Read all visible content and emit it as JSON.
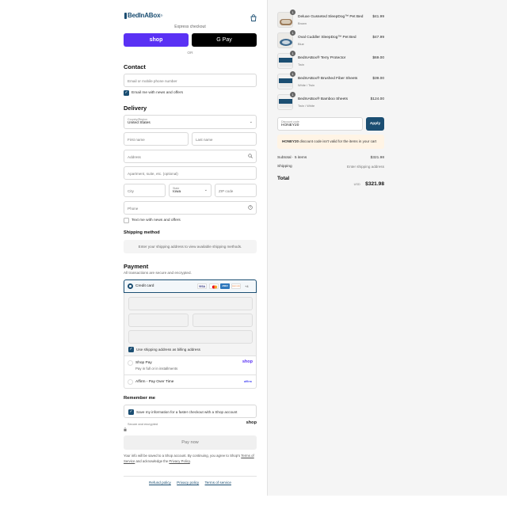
{
  "header": {
    "logo": "BedInABox",
    "logo_suffix": "®",
    "cart_icon": "shopping-bag-icon"
  },
  "express": {
    "title": "Express checkout",
    "shop_pay_label": "shop",
    "gpay_label": "G Pay",
    "or_label": "OR"
  },
  "contact": {
    "heading": "Contact",
    "email_placeholder": "Email or mobile phone number",
    "news_label": "Email me with news and offers",
    "news_checked": true
  },
  "delivery": {
    "heading": "Delivery",
    "country_label": "Country/Region",
    "country_value": "United States",
    "first_name": "First name",
    "last_name": "Last name",
    "address": "Address",
    "apartment": "Apartment, suite, etc. (optional)",
    "city": "City",
    "state_label": "State",
    "state_value": "Iowa",
    "zip": "ZIP code",
    "phone": "Phone",
    "sms_label": "Text me with news and offers"
  },
  "shipping_method": {
    "heading": "Shipping method",
    "notice": "Enter your shipping address to view available shipping methods."
  },
  "payment": {
    "heading": "Payment",
    "subtitle": "All transactions are secure and encrypted.",
    "credit_card_label": "Credit card",
    "card_brands": [
      "VISA",
      "MC",
      "AMEX",
      "DISCOVER"
    ],
    "more_brands": "+4",
    "billing_label": "Use shipping address as billing address",
    "shop_pay_title": "Shop Pay",
    "shop_pay_sub": "Pay in full or in installments",
    "shop_pay_logo": "shop",
    "affirm_label": "Affirm - Pay Over Time",
    "affirm_logo": "affirm"
  },
  "remember": {
    "heading": "Remember me",
    "save_label": "Save my information for a faster checkout with a Shop account",
    "secure_label": "Secure and encrypted",
    "shop_logo": "shop"
  },
  "pay_button": "Pay now",
  "legal": {
    "line1": "Your info will be saved to a Shop account. By continuing, you agree to Shop's",
    "tos": "Terms of Service",
    "and": "and acknowledge the",
    "privacy": "Privacy Policy",
    "end": "."
  },
  "footer_links": [
    "Refund policy",
    "Privacy policy",
    "Terms of service"
  ],
  "cart": {
    "items": [
      {
        "name": "Deluxe Gusseted SleepDog™ Pet Bed",
        "variant": "Brown",
        "price": "$41.99",
        "qty": "1"
      },
      {
        "name": "Oval Cuddler SleepDog™ Pet Bed",
        "variant": "Blue",
        "price": "$47.99",
        "qty": "1"
      },
      {
        "name": "BedInABox® Terry Protector",
        "variant": "Twin",
        "price": "$69.00",
        "qty": "1"
      },
      {
        "name": "BedInABox® Brushed Fiber Sheets",
        "variant": "White / Twin",
        "price": "$39.00",
        "qty": "1"
      },
      {
        "name": "BedInABox® Bamboo Sheets",
        "variant": "Twin / White",
        "price": "$124.00",
        "qty": "1"
      }
    ],
    "discount_label": "Discount code",
    "discount_value": "HONEY20",
    "apply_label": "Apply",
    "discount_code": "HONEY20",
    "discount_error": "discount code isn't valid for the items in your cart",
    "subtotal_label": "Subtotal · 5 items",
    "subtotal_value": "$321.98",
    "shipping_label": "Shipping",
    "shipping_value": "Enter shipping address",
    "total_label": "Total",
    "currency": "USD",
    "total_value": "$321.98"
  },
  "colors": {
    "accent": "#1b4e72",
    "shop_purple": "#5a31f4",
    "error_bg": "#fff4e5"
  }
}
